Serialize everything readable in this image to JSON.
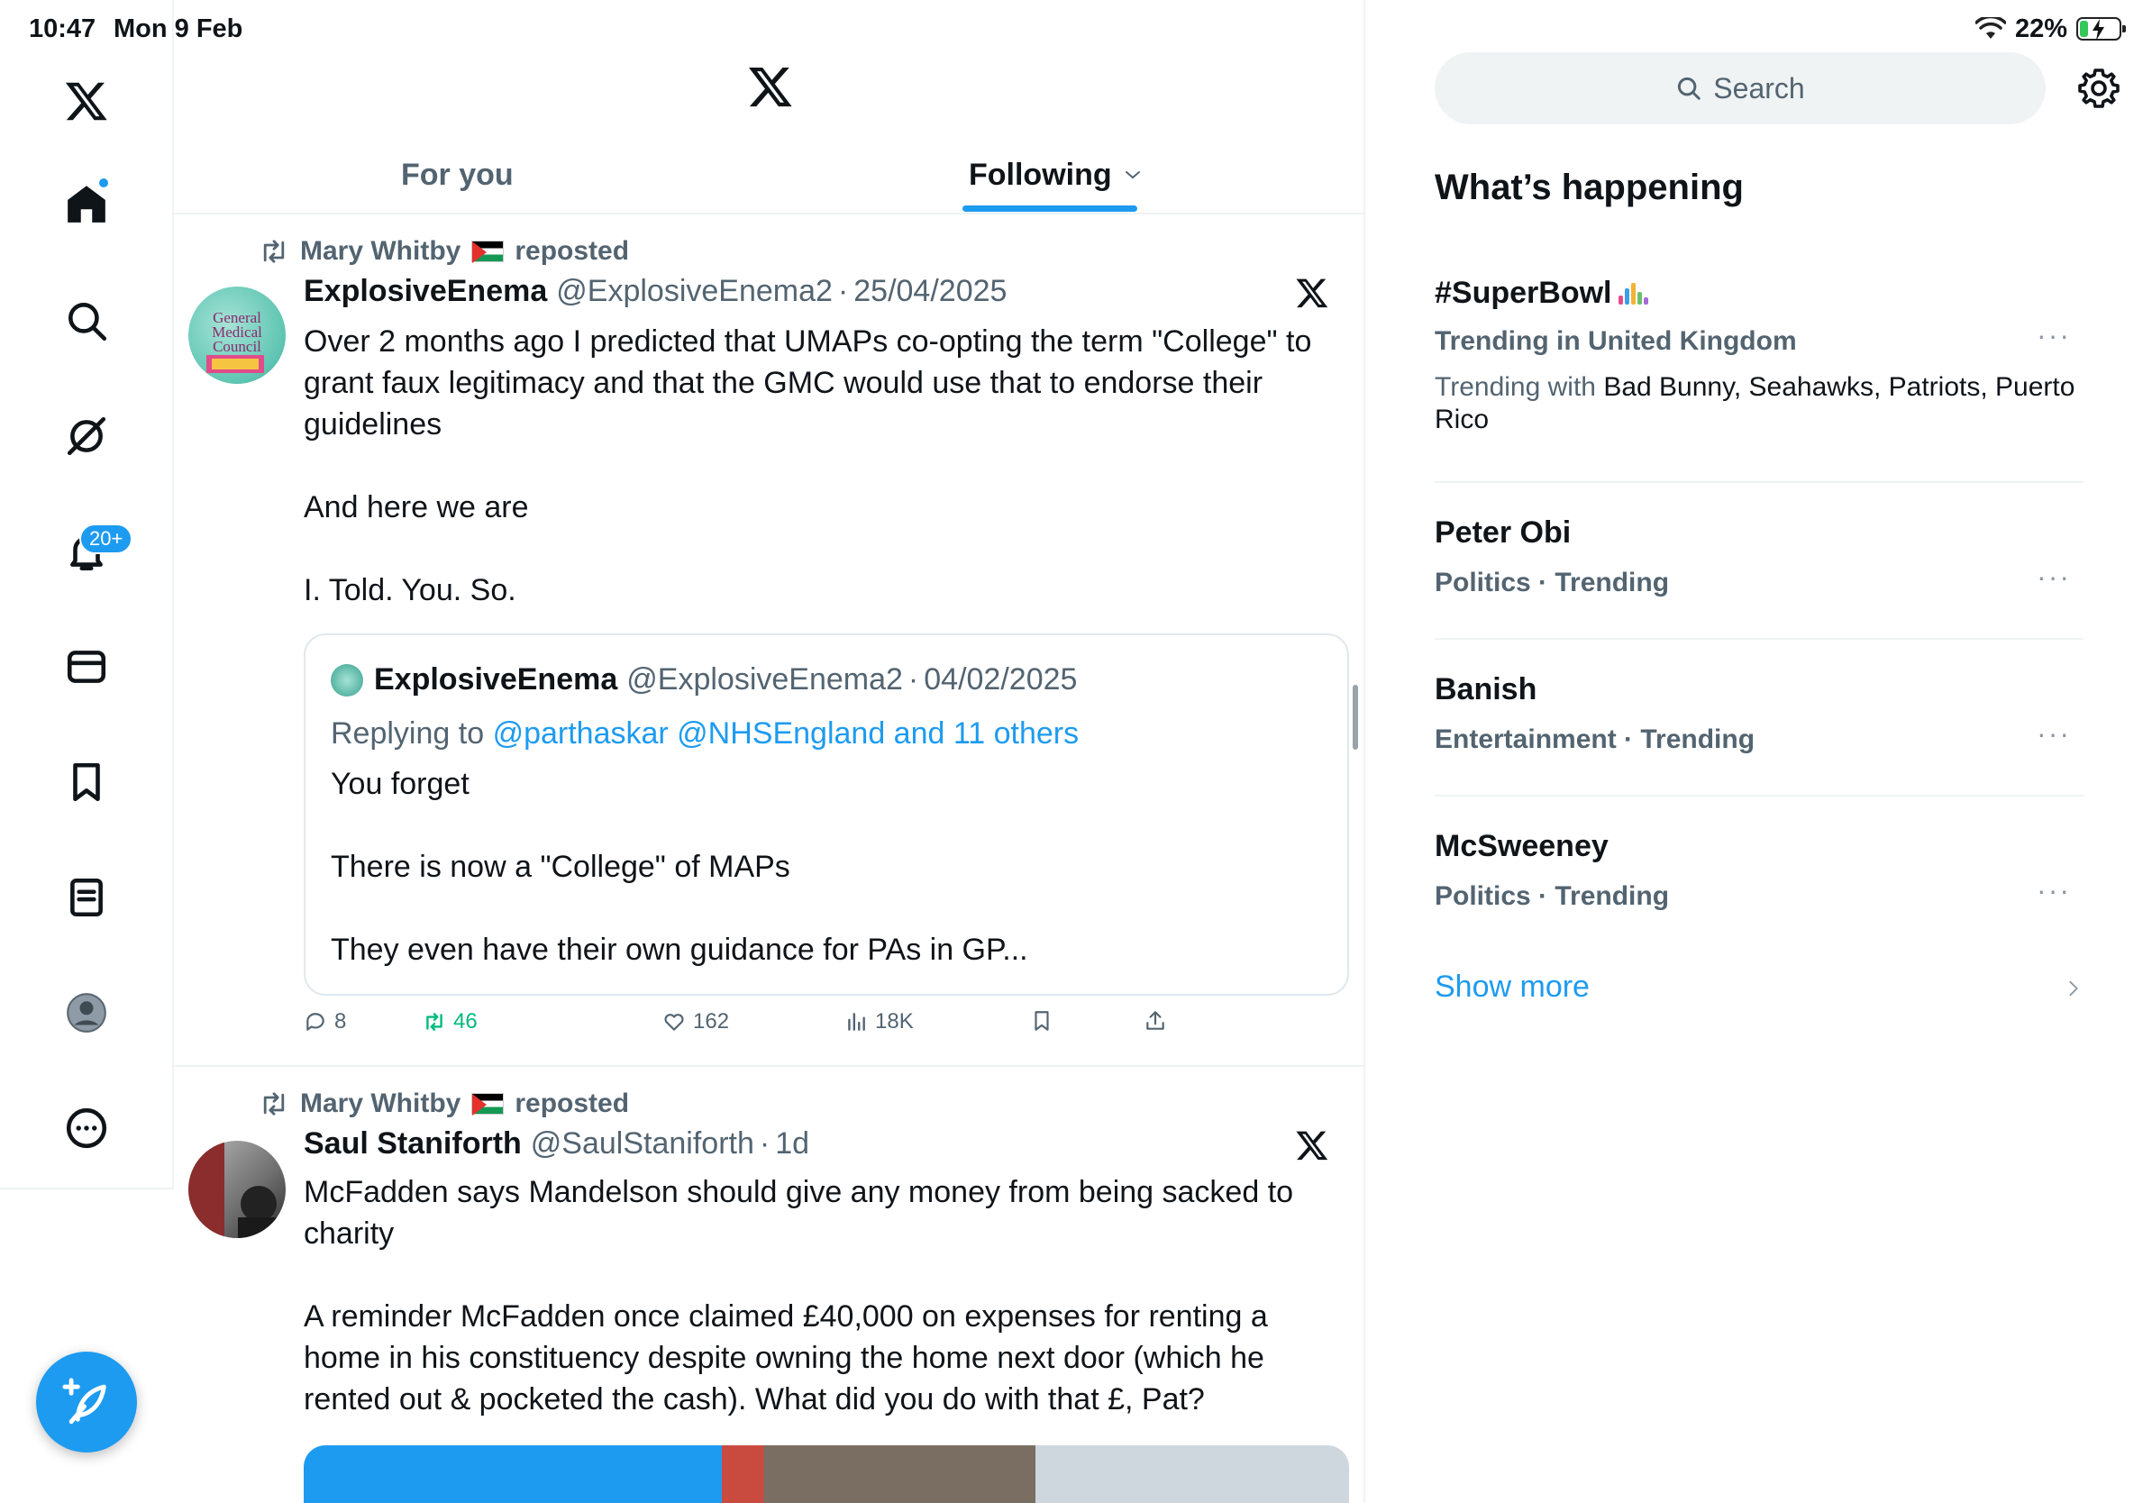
{
  "status_bar": {
    "time": "10:47",
    "date": "Mon 9 Feb",
    "battery_percent": "22%",
    "battery_level": 0.22
  },
  "nav": {
    "notifications_badge": "20+",
    "icons": [
      "x-logo-icon",
      "home-icon",
      "search-icon",
      "grok-icon",
      "bell-icon",
      "mail-icon",
      "bookmark-icon",
      "lists-icon",
      "profile-icon",
      "more-icon"
    ]
  },
  "tabs": {
    "for_you": "For you",
    "following": "Following"
  },
  "posts": [
    {
      "reposted_by": "Mary Whitby",
      "repost_suffix": "reposted",
      "author": "ExplosiveEnema",
      "handle": "@ExplosiveEnema2",
      "timestamp": "25/04/2025",
      "text": "Over 2 months ago I predicted that UMAPs co-opting the term \"College\" to grant faux legitimacy and that the GMC would use that to endorse their guidelines\n\nAnd here we are\n\nI. Told. You. So.",
      "avatar_caption": "General Medical Council",
      "quote": {
        "author": "ExplosiveEnema",
        "handle": "@ExplosiveEnema2",
        "timestamp": "04/02/2025",
        "replying_to_label": "Replying to",
        "replying_to_mentions": "@parthaskar @NHSEngland and 11 others",
        "text": "You forget\n\nThere is now a \"College\" of MAPs\n\nThey even have their own guidance for PAs in GP..."
      },
      "stats": {
        "replies": "8",
        "reposts": "46",
        "likes": "162",
        "views": "18K"
      }
    },
    {
      "reposted_by": "Mary Whitby",
      "repost_suffix": "reposted",
      "author": "Saul Staniforth",
      "handle": "@SaulStaniforth",
      "timestamp": "1d",
      "text": "McFadden says Mandelson should give any money from being sacked to charity\n\nA reminder McFadden once claimed £40,000 on expenses for renting a home in his constituency despite owning the home next door (which he rented out & pocketed the cash). What did you do with that £, Pat?"
    }
  ],
  "sidebar": {
    "search_placeholder": "Search",
    "whats_happening": "What’s happening",
    "trends": [
      {
        "name": "#SuperBowl",
        "context": "Trending in United Kingdom",
        "with_label": "Trending with",
        "with_names": "Bad Bunny, Seahawks, Patriots, Puerto Rico"
      },
      {
        "name": "Peter Obi",
        "context": "Politics · Trending"
      },
      {
        "name": "Banish",
        "context": "Entertainment · Trending"
      },
      {
        "name": "McSweeney",
        "context": "Politics · Trending"
      }
    ],
    "more_label": "···",
    "show_more": "Show more"
  },
  "colors": {
    "accent": "#1d9bf0",
    "secondary_text": "#536471",
    "retweet_green": "#00ba7c",
    "divider": "#eff3f4"
  }
}
